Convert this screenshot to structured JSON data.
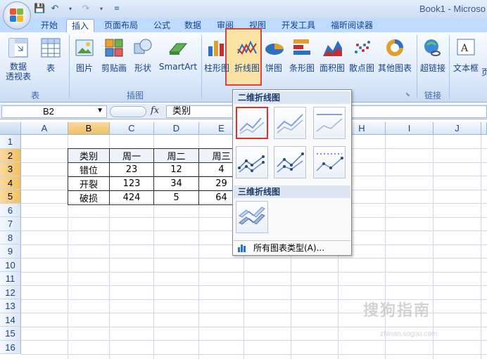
{
  "window": {
    "title": "Book1 - Microso"
  },
  "quick_access": {
    "save_icon": "save-icon",
    "undo_icon": "undo-icon",
    "redo_icon": "redo-icon"
  },
  "tabs": [
    "开始",
    "插入",
    "页面布局",
    "公式",
    "数据",
    "审阅",
    "视图",
    "开发工具",
    "福昕阅读器"
  ],
  "active_tab": "插入",
  "ribbon": {
    "buttons": [
      {
        "label": "数据\n透视表",
        "icon": "pivottable-icon"
      },
      {
        "label": "表",
        "icon": "table-icon"
      },
      {
        "label": "图片",
        "icon": "picture-icon"
      },
      {
        "label": "剪贴画",
        "icon": "clipart-icon"
      },
      {
        "label": "形状",
        "icon": "shapes-icon"
      },
      {
        "label": "SmartArt",
        "icon": "smartart-icon"
      },
      {
        "label": "柱形图",
        "icon": "column-chart-icon"
      },
      {
        "label": "折线图",
        "icon": "line-chart-icon"
      },
      {
        "label": "饼图",
        "icon": "pie-chart-icon"
      },
      {
        "label": "条形图",
        "icon": "bar-chart-icon"
      },
      {
        "label": "面积图",
        "icon": "area-chart-icon"
      },
      {
        "label": "散点图",
        "icon": "scatter-chart-icon"
      },
      {
        "label": "其他图表",
        "icon": "other-charts-icon"
      },
      {
        "label": "超链接",
        "icon": "hyperlink-icon"
      },
      {
        "label": "文本框",
        "icon": "textbox-icon"
      },
      {
        "label": "页",
        "icon": "header-icon"
      }
    ],
    "groups": [
      "表",
      "插图",
      "链接"
    ]
  },
  "formula_bar": {
    "name_box": "B2",
    "fx": "fx",
    "value": "类别"
  },
  "columns": [
    "A",
    "B",
    "C",
    "D",
    "E",
    "F",
    "G",
    "H",
    "I",
    "J"
  ],
  "selected_column": "B",
  "rows": [
    "1",
    "2",
    "3",
    "4",
    "5",
    "6",
    "7",
    "8",
    "9",
    "10",
    "11",
    "12",
    "13",
    "14",
    "15",
    "16"
  ],
  "selected_rows": [
    "2",
    "3",
    "4",
    "5"
  ],
  "table": {
    "header": [
      "类别",
      "周一",
      "周二",
      "周三"
    ],
    "rows": [
      [
        "错位",
        "23",
        "12",
        "4"
      ],
      [
        "开裂",
        "123",
        "34",
        "29"
      ],
      [
        "破损",
        "424",
        "5",
        "64"
      ]
    ]
  },
  "dropdown": {
    "section_2d": "二维折线图",
    "section_3d": "三维折线图",
    "all_types": "所有图表类型(A)..."
  },
  "watermark": {
    "main": "搜狗指南",
    "sub": "zhinan.sogou.com"
  }
}
